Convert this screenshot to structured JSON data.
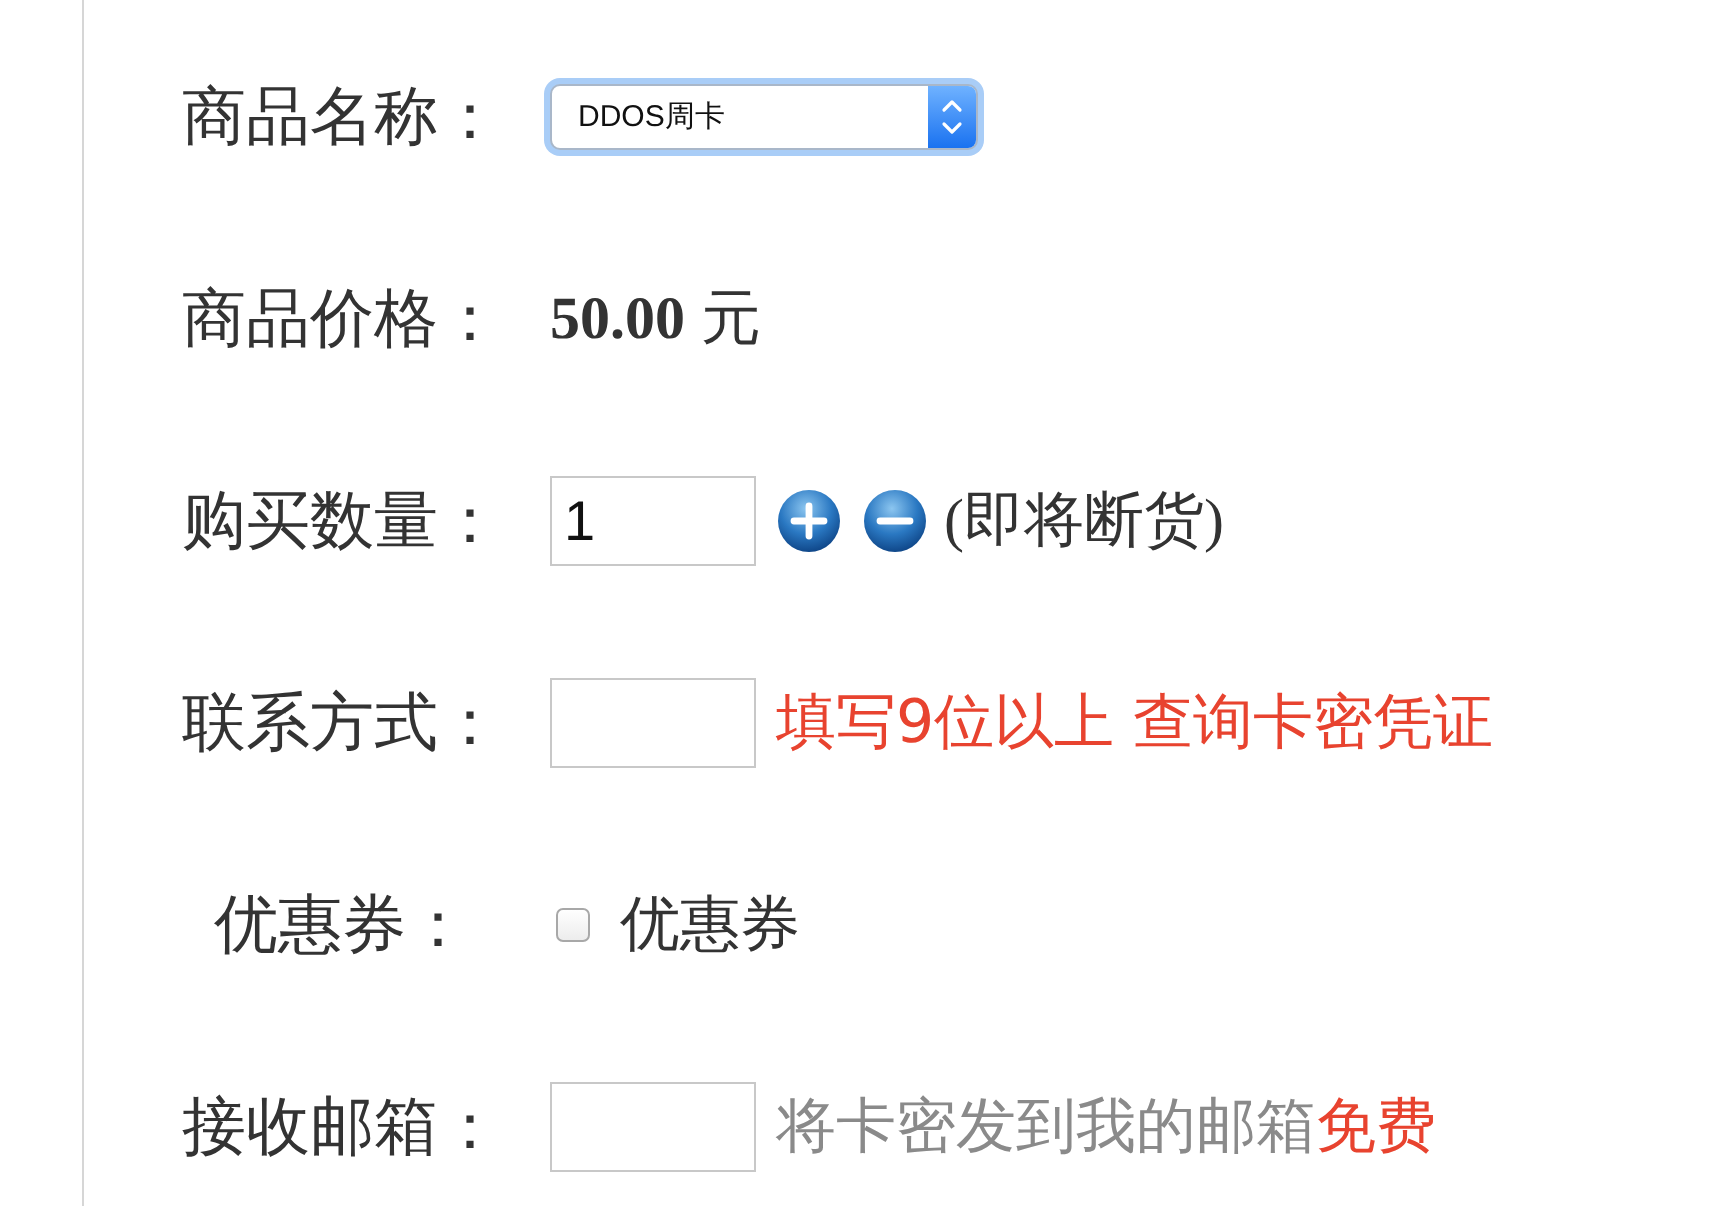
{
  "form": {
    "rows": [
      {
        "kind": "select",
        "label": "商品名称：",
        "value": "DDOS周卡",
        "focused": true
      },
      {
        "kind": "price",
        "label": "商品价格：",
        "amount": "50.00",
        "unit": "元"
      },
      {
        "kind": "quantity",
        "label": "购买数量：",
        "value": "1",
        "note": "(即将断货)"
      },
      {
        "kind": "contact",
        "label": "联系方式：",
        "note": "填写9位以上 查询卡密凭证"
      },
      {
        "kind": "checkbox",
        "label": "优惠券：",
        "checked": false,
        "option": "优惠券"
      },
      {
        "kind": "email",
        "label": "接收邮箱：",
        "note": "将卡密发到我的邮箱",
        "highlight": "免费"
      }
    ]
  }
}
